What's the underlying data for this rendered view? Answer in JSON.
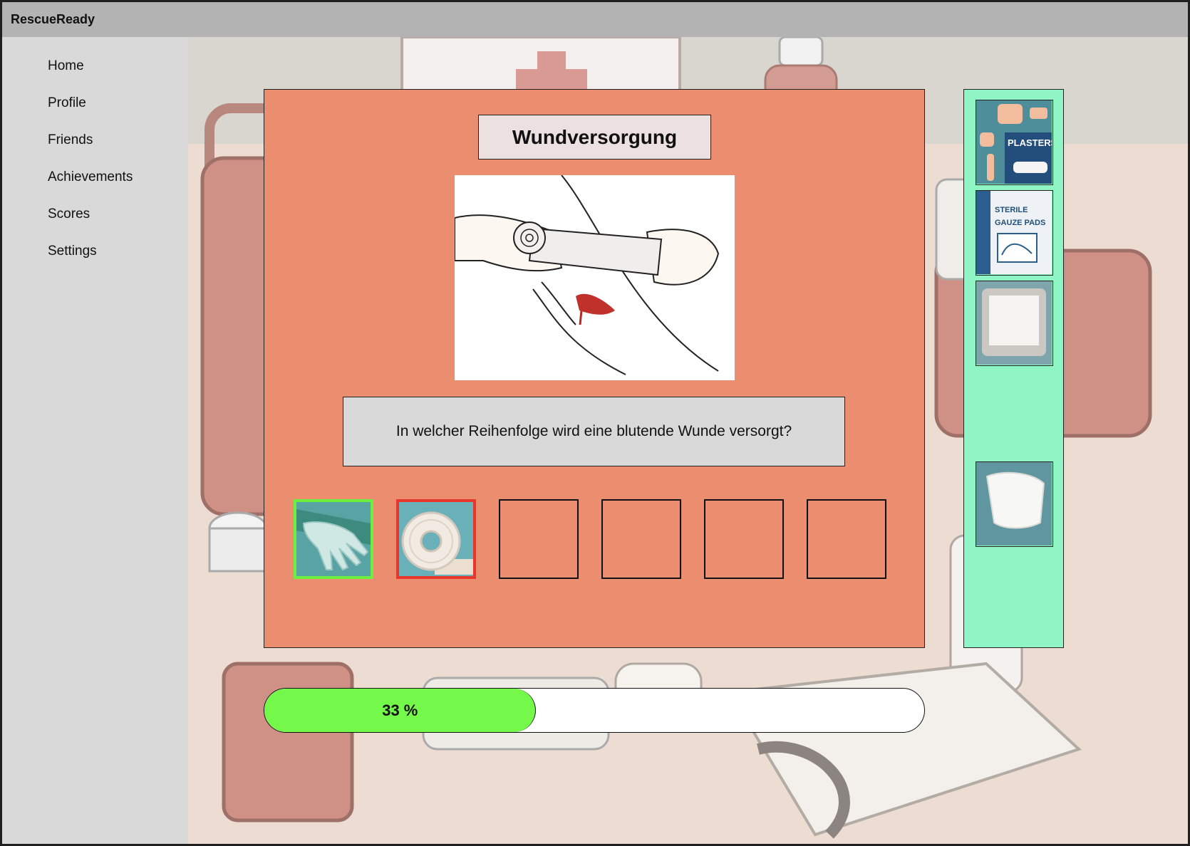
{
  "app": {
    "title": "RescueReady"
  },
  "sidebar": {
    "items": [
      {
        "label": "Home"
      },
      {
        "label": "Profile"
      },
      {
        "label": "Friends"
      },
      {
        "label": "Achievements"
      },
      {
        "label": "Scores"
      },
      {
        "label": "Settings"
      }
    ]
  },
  "quiz": {
    "title": "Wundversorgung",
    "question": "In welcher Reihenfolge wird eine blutende Wunde versorgt?",
    "slots": [
      {
        "content": "gloves",
        "state": "correct"
      },
      {
        "content": "bandage-roll",
        "state": "wrong"
      },
      {
        "content": "empty",
        "state": "empty"
      },
      {
        "content": "empty",
        "state": "empty"
      },
      {
        "content": "empty",
        "state": "empty"
      },
      {
        "content": "empty",
        "state": "empty"
      }
    ]
  },
  "tray": {
    "items": [
      {
        "name": "plasters",
        "label": "PLASTERS"
      },
      {
        "name": "sterile-gauze-pads",
        "label_line1": "STERILE",
        "label_line2": "GAUZE PADS"
      },
      {
        "name": "gauze-pad"
      },
      {
        "name": "compress-dressing"
      }
    ]
  },
  "progress": {
    "percent": 33,
    "label": "33 %"
  },
  "colors": {
    "panel": "#ea8e6f",
    "tray": "#90f5c4",
    "progress_fill": "#74f84a",
    "correct_border": "#6cf040",
    "wrong_border": "#e8362a"
  }
}
